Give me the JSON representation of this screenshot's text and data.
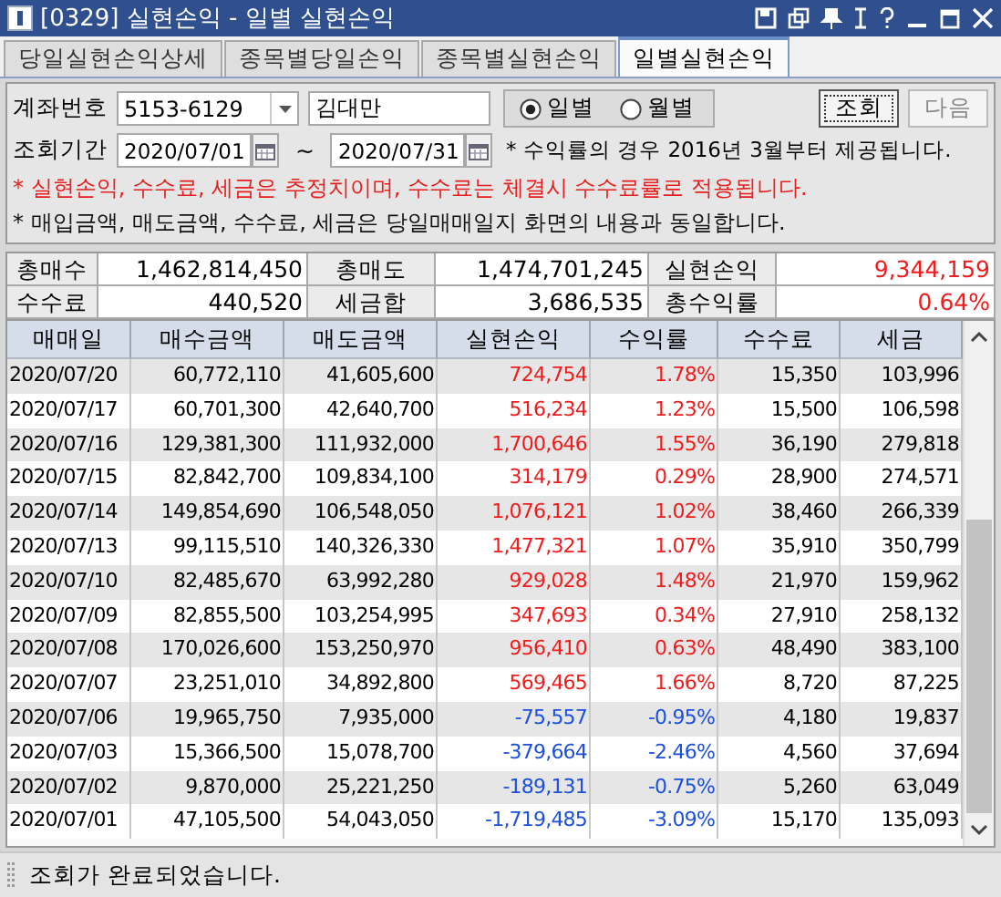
{
  "window": {
    "title": "[0329] 실현손익 - 일별 실현손익"
  },
  "tabs": [
    {
      "label": "당일실현손익상세",
      "selected": false
    },
    {
      "label": "종목별당일손익",
      "selected": false
    },
    {
      "label": "종목별실현손익",
      "selected": false
    },
    {
      "label": "일별실현손익",
      "selected": true
    }
  ],
  "query": {
    "account_label": "계좌번호",
    "account_number": "5153-6129",
    "account_name": "김대만",
    "period_options": [
      {
        "label": "일별",
        "selected": true
      },
      {
        "label": "월별",
        "selected": false
      }
    ],
    "search_button": "조회",
    "next_button": {
      "label": "다음",
      "disabled": true
    },
    "period_label": "조회기간",
    "start_date": "2020/07/01",
    "range_separator": "~",
    "end_date": "2020/07/31",
    "note": "* 수익률의 경우 2016년 3월부터 제공됩니다."
  },
  "notices": [
    {
      "text": "* 실현손익, 수수료, 세금은 추정치이며, 수수료는 체결시 수수료률로 적용됩니다.",
      "kind": "warning"
    },
    {
      "text": "* 매입금액, 매도금액, 수수료, 세금은 당일매매일지 화면의 내용과 동일합니다.",
      "kind": "info"
    }
  ],
  "summary": [
    {
      "label": "총매수",
      "value": "1,462,814,450",
      "kind": "plain"
    },
    {
      "label": "총매도",
      "value": "1,474,701,245",
      "kind": "plain"
    },
    {
      "label": "실현손익",
      "value": "9,344,159",
      "kind": "gain"
    },
    {
      "label": "수수료",
      "value": "440,520",
      "kind": "plain"
    },
    {
      "label": "세금합",
      "value": "3,686,535",
      "kind": "plain"
    },
    {
      "label": "총수익률",
      "value": "0.64%",
      "kind": "gain"
    }
  ],
  "table": {
    "columns": [
      "매매일",
      "매수금액",
      "매도금액",
      "실현손익",
      "수익률",
      "수수료",
      "세금"
    ],
    "rows": [
      {
        "kind": "gain",
        "cells": [
          "2020/07/20",
          "60,772,110",
          "41,605,600",
          "724,754",
          "1.78%",
          "15,350",
          "103,996"
        ]
      },
      {
        "kind": "gain",
        "cells": [
          "2020/07/17",
          "60,701,300",
          "42,640,700",
          "516,234",
          "1.23%",
          "15,500",
          "106,598"
        ]
      },
      {
        "kind": "gain",
        "cells": [
          "2020/07/16",
          "129,381,300",
          "111,932,000",
          "1,700,646",
          "1.55%",
          "36,190",
          "279,818"
        ]
      },
      {
        "kind": "gain",
        "cells": [
          "2020/07/15",
          "82,842,700",
          "109,834,100",
          "314,179",
          "0.29%",
          "28,900",
          "274,571"
        ]
      },
      {
        "kind": "gain",
        "cells": [
          "2020/07/14",
          "149,854,690",
          "106,548,050",
          "1,076,121",
          "1.02%",
          "38,460",
          "266,339"
        ]
      },
      {
        "kind": "gain",
        "cells": [
          "2020/07/13",
          "99,115,510",
          "140,326,330",
          "1,477,321",
          "1.07%",
          "35,910",
          "350,799"
        ]
      },
      {
        "kind": "gain",
        "cells": [
          "2020/07/10",
          "82,485,670",
          "63,992,280",
          "929,028",
          "1.48%",
          "21,970",
          "159,962"
        ]
      },
      {
        "kind": "gain",
        "cells": [
          "2020/07/09",
          "82,855,500",
          "103,254,995",
          "347,693",
          "0.34%",
          "27,910",
          "258,132"
        ]
      },
      {
        "kind": "gain",
        "cells": [
          "2020/07/08",
          "170,026,600",
          "153,250,970",
          "956,410",
          "0.63%",
          "48,490",
          "383,100"
        ]
      },
      {
        "kind": "gain",
        "cells": [
          "2020/07/07",
          "23,251,010",
          "34,892,800",
          "569,465",
          "1.66%",
          "8,720",
          "87,225"
        ]
      },
      {
        "kind": "loss",
        "cells": [
          "2020/07/06",
          "19,965,750",
          "7,935,000",
          "-75,557",
          "-0.95%",
          "4,180",
          "19,837"
        ]
      },
      {
        "kind": "loss",
        "cells": [
          "2020/07/03",
          "15,366,500",
          "15,078,700",
          "-379,664",
          "-2.46%",
          "4,560",
          "37,694"
        ]
      },
      {
        "kind": "loss",
        "cells": [
          "2020/07/02",
          "9,870,000",
          "25,221,250",
          "-189,131",
          "-0.75%",
          "5,260",
          "63,049"
        ]
      },
      {
        "kind": "loss",
        "cells": [
          "2020/07/01",
          "47,105,500",
          "54,043,050",
          "-1,719,485",
          "-3.09%",
          "15,170",
          "135,093"
        ]
      }
    ]
  },
  "status_bar": "조회가 완료되었습니다."
}
